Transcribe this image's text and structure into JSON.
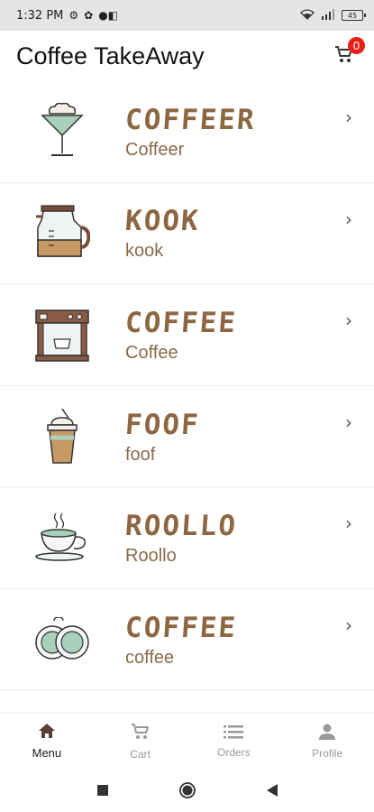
{
  "status_bar": {
    "time": "1:32 PM",
    "battery": "45"
  },
  "app_bar": {
    "title": "Coffee TakeAway",
    "cart_count": "0"
  },
  "menu_items": [
    {
      "name": "COFFEER",
      "subtitle": "Coffeer",
      "icon": "martini-glass-icon"
    },
    {
      "name": "KOOK",
      "subtitle": "kook",
      "icon": "coffee-pot-icon"
    },
    {
      "name": "COFFEE",
      "subtitle": "Coffee",
      "icon": "espresso-machine-icon"
    },
    {
      "name": "FOOF",
      "subtitle": "foof",
      "icon": "iced-coffee-icon"
    },
    {
      "name": "ROOLLO",
      "subtitle": "Roollo",
      "icon": "coffee-cup-icon"
    },
    {
      "name": "COFFEE",
      "subtitle": "coffee",
      "icon": "coffee-beans-icon"
    }
  ],
  "chevron": "›",
  "bottom_nav": [
    {
      "label": "Menu",
      "icon": "home-icon",
      "active": true
    },
    {
      "label": "Cart",
      "icon": "cart-icon",
      "active": false
    },
    {
      "label": "Orders",
      "icon": "list-icon",
      "active": false
    },
    {
      "label": "Profile",
      "icon": "person-icon",
      "active": false
    }
  ],
  "colors": {
    "brand": "#8d6741",
    "badge": "#e8201a",
    "active_nav": "#5a3e36",
    "inactive_nav": "#999999"
  }
}
